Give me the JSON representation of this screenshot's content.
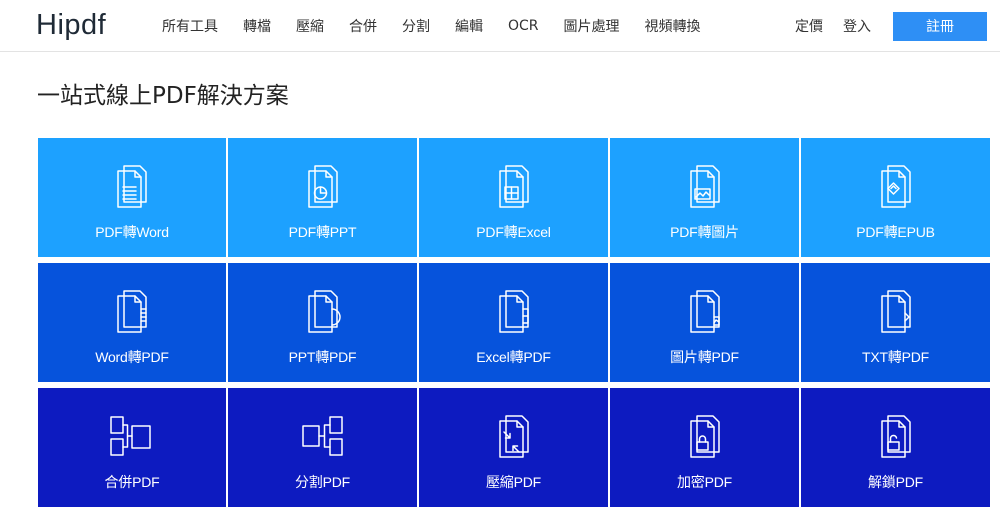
{
  "header": {
    "logo": "Hipdf",
    "nav": [
      "所有工具",
      "轉檔",
      "壓縮",
      "合併",
      "分割",
      "編輯",
      "OCR",
      "圖片處理",
      "視頻轉換"
    ],
    "pricing": "定價",
    "login": "登入",
    "register": "註冊"
  },
  "main": {
    "title": "一站式線上PDF解決方案"
  },
  "tools": [
    {
      "label": "PDF轉Word",
      "icon": "pdf-to-word-icon"
    },
    {
      "label": "PDF轉PPT",
      "icon": "pdf-to-ppt-icon"
    },
    {
      "label": "PDF轉Excel",
      "icon": "pdf-to-excel-icon"
    },
    {
      "label": "PDF轉圖片",
      "icon": "pdf-to-image-icon"
    },
    {
      "label": "PDF轉EPUB",
      "icon": "pdf-to-epub-icon"
    },
    {
      "label": "Word轉PDF",
      "icon": "word-to-pdf-icon"
    },
    {
      "label": "PPT轉PDF",
      "icon": "ppt-to-pdf-icon"
    },
    {
      "label": "Excel轉PDF",
      "icon": "excel-to-pdf-icon"
    },
    {
      "label": "圖片轉PDF",
      "icon": "image-to-pdf-icon"
    },
    {
      "label": "TXT轉PDF",
      "icon": "txt-to-pdf-icon"
    },
    {
      "label": "合併PDF",
      "icon": "merge-pdf-icon"
    },
    {
      "label": "分割PDF",
      "icon": "split-pdf-icon"
    },
    {
      "label": "壓縮PDF",
      "icon": "compress-pdf-icon"
    },
    {
      "label": "加密PDF",
      "icon": "lock-pdf-icon"
    },
    {
      "label": "解鎖PDF",
      "icon": "unlock-pdf-icon"
    }
  ],
  "colors": {
    "row1": "#1da1ff",
    "row2": "#0653dc",
    "row3": "#0d1bc0",
    "accent": "#2e8ff5"
  }
}
